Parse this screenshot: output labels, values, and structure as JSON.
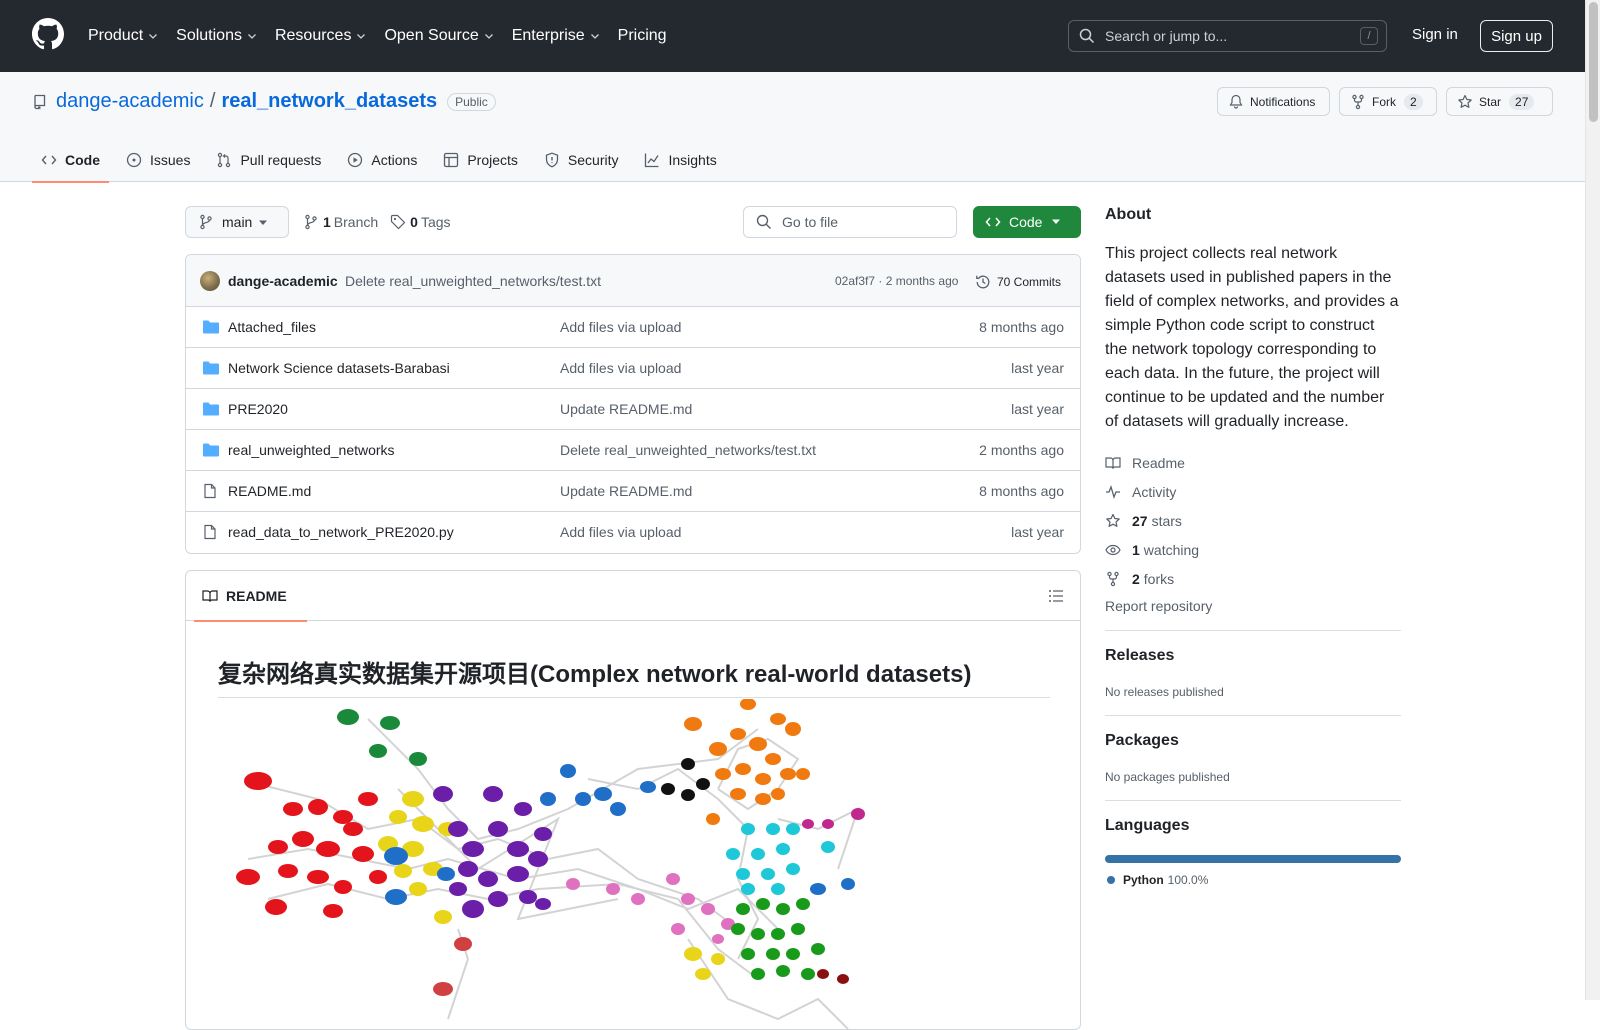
{
  "header": {
    "nav": [
      {
        "label": "Product",
        "has_menu": true
      },
      {
        "label": "Solutions",
        "has_menu": true
      },
      {
        "label": "Resources",
        "has_menu": true
      },
      {
        "label": "Open Source",
        "has_menu": true
      },
      {
        "label": "Enterprise",
        "has_menu": true
      },
      {
        "label": "Pricing",
        "has_menu": false
      }
    ],
    "search_placeholder": "Search or jump to...",
    "search_shortcut": "/",
    "sign_in": "Sign in",
    "sign_up": "Sign up"
  },
  "repo": {
    "owner": "dange-academic",
    "separator": "/",
    "name": "real_network_datasets",
    "visibility": "Public",
    "notifications_label": "Notifications",
    "fork_label": "Fork",
    "fork_count": "2",
    "star_label": "Star",
    "star_count": "27",
    "tabs": [
      {
        "label": "Code",
        "icon": "code-icon",
        "active": true
      },
      {
        "label": "Issues",
        "icon": "issue-icon",
        "active": false
      },
      {
        "label": "Pull requests",
        "icon": "pull-request-icon",
        "active": false
      },
      {
        "label": "Actions",
        "icon": "play-icon",
        "active": false
      },
      {
        "label": "Projects",
        "icon": "table-icon",
        "active": false
      },
      {
        "label": "Security",
        "icon": "shield-icon",
        "active": false
      },
      {
        "label": "Insights",
        "icon": "graph-icon",
        "active": false
      }
    ]
  },
  "filebar": {
    "branch": "main",
    "branch_count": "1",
    "branch_label": "Branch",
    "tag_count": "0",
    "tag_label": "Tags",
    "goto_placeholder": "Go to file",
    "code_button": "Code"
  },
  "commit": {
    "author": "dange-academic",
    "message": "Delete real_unweighted_networks/test.txt",
    "meta": "02af3f7 · 2 months ago",
    "count": "70 Commits"
  },
  "files": [
    {
      "type": "folder",
      "name": "Attached_files",
      "message": "Add files via upload",
      "date": "8 months ago"
    },
    {
      "type": "folder",
      "name": "Network Science datasets-Barabasi",
      "message": "Add files via upload",
      "date": "last year"
    },
    {
      "type": "folder",
      "name": "PRE2020",
      "message": "Update README.md",
      "date": "last year"
    },
    {
      "type": "folder",
      "name": "real_unweighted_networks",
      "message": "Delete real_unweighted_networks/test.txt",
      "date": "2 months ago"
    },
    {
      "type": "file",
      "name": "README.md",
      "message": "Update README.md",
      "date": "8 months ago"
    },
    {
      "type": "file",
      "name": "read_data_to_network_PRE2020.py",
      "message": "Add files via upload",
      "date": "last year"
    }
  ],
  "readme": {
    "tab_label": "README",
    "title": "复杂网络真实数据集开源项目(Complex network real-world datasets)"
  },
  "about": {
    "heading": "About",
    "description": "This project collects real network datasets used in published papers in the field of complex networks, and provides a simple Python code script to construct the network topology corresponding to each data. In the future, the project will continue to be updated and the number of datasets will gradually increase.",
    "readme": "Readme",
    "activity": "Activity",
    "stars_count": "27",
    "stars_label": "stars",
    "watching_count": "1",
    "watching_label": "watching",
    "forks_count": "2",
    "forks_label": "forks",
    "report": "Report repository"
  },
  "releases": {
    "heading": "Releases",
    "empty": "No releases published"
  },
  "packages": {
    "heading": "Packages",
    "empty": "No packages published"
  },
  "languages": {
    "heading": "Languages",
    "items": [
      {
        "name": "Python",
        "percent": "100.0%",
        "color": "#3572a5"
      }
    ]
  },
  "colors": {
    "header_bg": "#24292f",
    "accent_link": "#0969da",
    "code_button": "#1f883d",
    "tab_underline": "#fd8c73"
  }
}
